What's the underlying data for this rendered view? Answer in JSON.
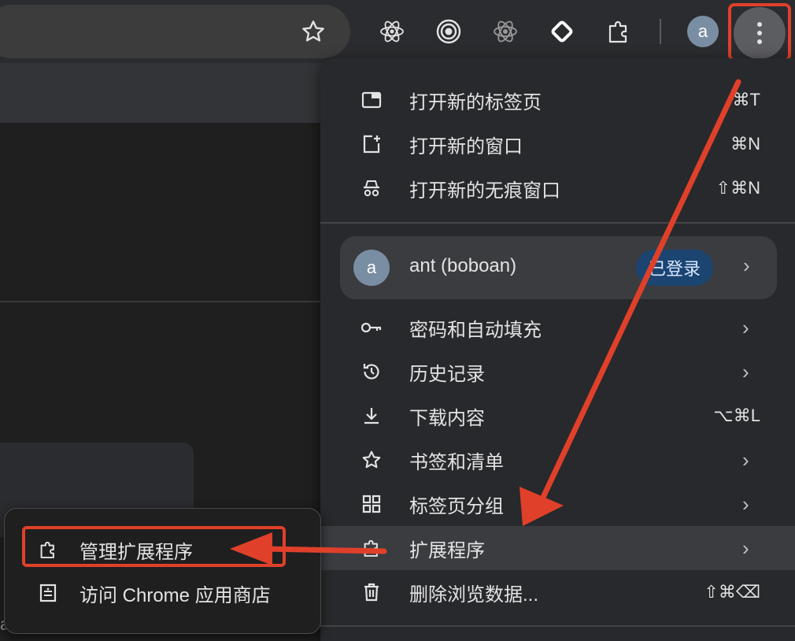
{
  "toolbar": {
    "bookmark_icon": "star-icon",
    "extensions": [
      "react-devtools-icon",
      "target-icon",
      "atom-icon",
      "diamond-icon",
      "puzzle-extensions-icon"
    ],
    "avatar_letter": "a",
    "menu_icon": "three-dots-icon"
  },
  "menu": {
    "items_top": [
      {
        "label": "打开新的标签页",
        "shortcut": "⌘T",
        "icon": "new-tab-icon"
      },
      {
        "label": "打开新的窗口",
        "shortcut": "⌘N",
        "icon": "new-window-icon"
      },
      {
        "label": "打开新的无痕窗口",
        "shortcut": "⇧⌘N",
        "icon": "incognito-icon"
      }
    ],
    "profile": {
      "avatar_letter": "a",
      "name": "ant (boboan)",
      "badge": "已登录"
    },
    "items_bottom": [
      {
        "label": "密码和自动填充",
        "shortcut": "",
        "icon": "key-icon",
        "submenu": true
      },
      {
        "label": "历史记录",
        "shortcut": "",
        "icon": "history-icon",
        "submenu": true
      },
      {
        "label": "下载内容",
        "shortcut": "⌥⌘L",
        "icon": "download-icon",
        "submenu": false
      },
      {
        "label": "书签和清单",
        "shortcut": "",
        "icon": "star-icon",
        "submenu": true
      },
      {
        "label": "标签页分组",
        "shortcut": "",
        "icon": "tab-groups-icon",
        "submenu": true
      },
      {
        "label": "扩展程序",
        "shortcut": "",
        "icon": "puzzle-icon",
        "submenu": true
      },
      {
        "label": "删除浏览数据...",
        "shortcut": "⇧⌘⌫",
        "icon": "trash-icon",
        "submenu": false
      }
    ]
  },
  "submenu": {
    "items": [
      {
        "label": "管理扩展程序",
        "icon": "puzzle-icon"
      },
      {
        "label": "访问 Chrome 应用商店",
        "icon": "web-store-icon"
      }
    ]
  },
  "page": {
    "stray_text": "a"
  },
  "colors": {
    "annotation": "#e0402a",
    "menu_bg": "#28292c",
    "hover": "#3b3c40",
    "badge_bg": "#1b4470"
  }
}
